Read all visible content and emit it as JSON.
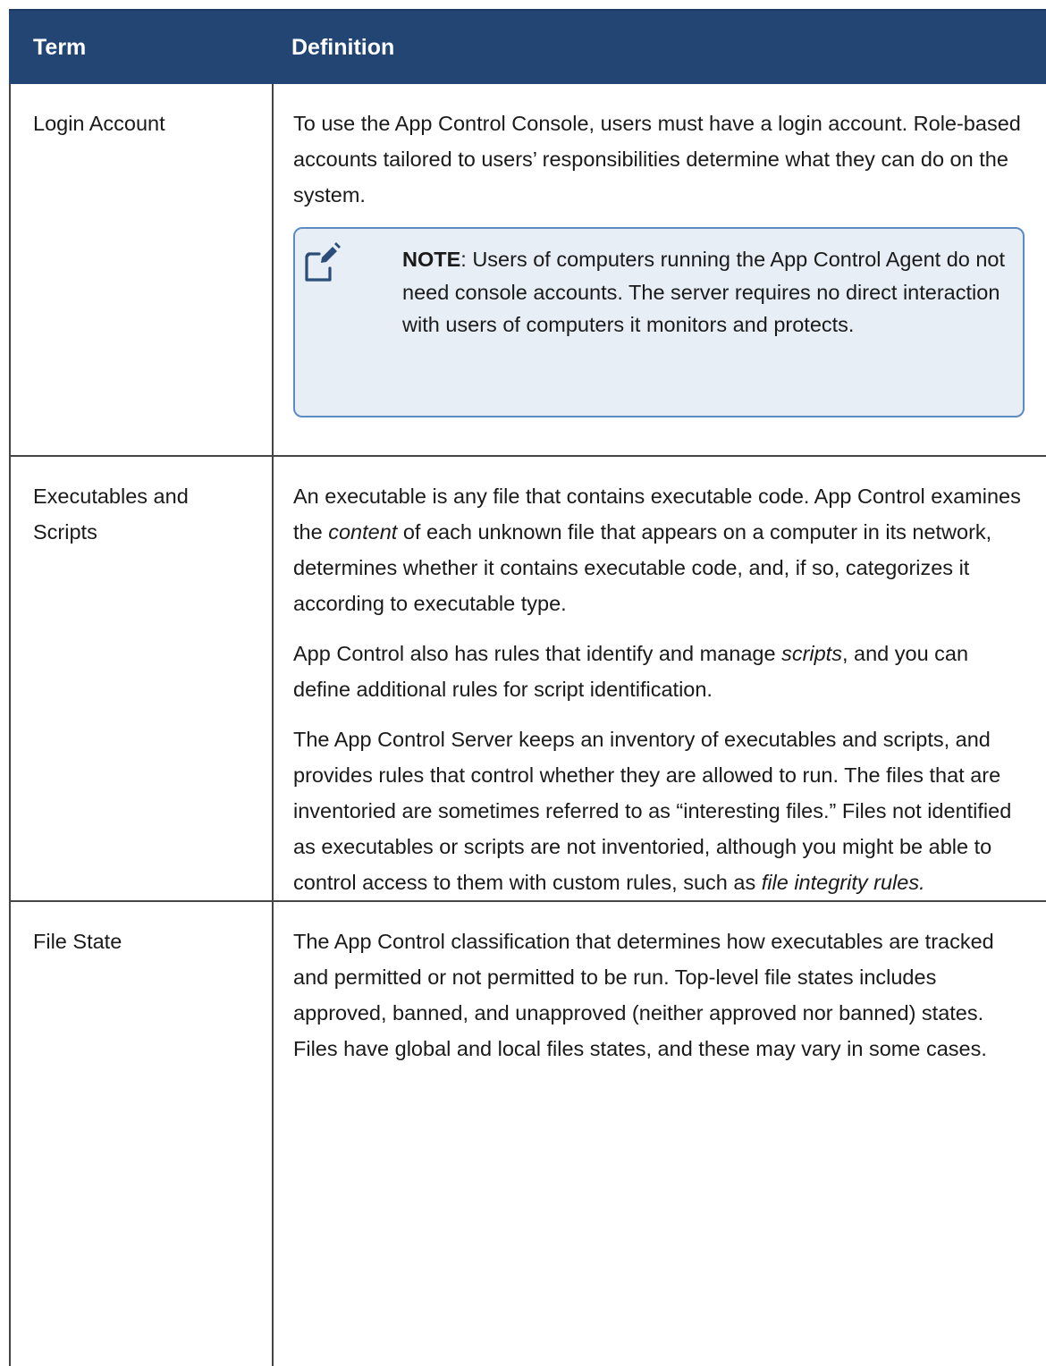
{
  "table": {
    "headers": {
      "term": "Term",
      "definition": "Definition"
    },
    "rows": [
      {
        "term": "Login Account",
        "definition": [
          "To use the App Control Console, users must have a login account. Role-based accounts tailored to users’ responsibilities determine what they can do on the system."
        ],
        "note": {
          "label": "NOTE",
          "text": ": Users of computers running the App Control Agent do not need console accounts. The server requires no direct interaction with users of computers it monitors and protects.",
          "icon": "note-pencil-icon"
        }
      },
      {
        "term": "Executables and Scripts",
        "definition": [
          {
            "before": "An executable is any file that contains executable code. App Control examines the ",
            "italic": "content",
            "after": " of each unknown file that appears on a computer in its network, determines whether it contains executable code, and, if so, categorizes it according to executable type."
          },
          {
            "before": "App Control also has rules that identify and manage ",
            "italic": "scripts",
            "after": ", and you can define additional rules for script identification."
          },
          {
            "before": "The App Control Server keeps an inventory of executables and scripts, and provides rules that control whether they are allowed to run. The files that are inventoried are sometimes referred to as “interesting files.” Files not identified as executables or scripts are not inventoried, although you might be able to control access to them with custom rules, such as ",
            "italic": "file integrity rules.",
            "after": ""
          }
        ]
      },
      {
        "term": "File State",
        "definition": [
          "The App Control classification that determines how executables are tracked and permitted or not permitted to be run. Top-level file states includes approved, banned, and unapproved (neither approved nor banned) states. Files have global and local files states, and these may vary in some cases."
        ]
      }
    ]
  },
  "colors": {
    "header_bg": "#234574",
    "note_bg": "#e8eef6",
    "note_border": "#5d8bc4",
    "rule": "#444444"
  }
}
